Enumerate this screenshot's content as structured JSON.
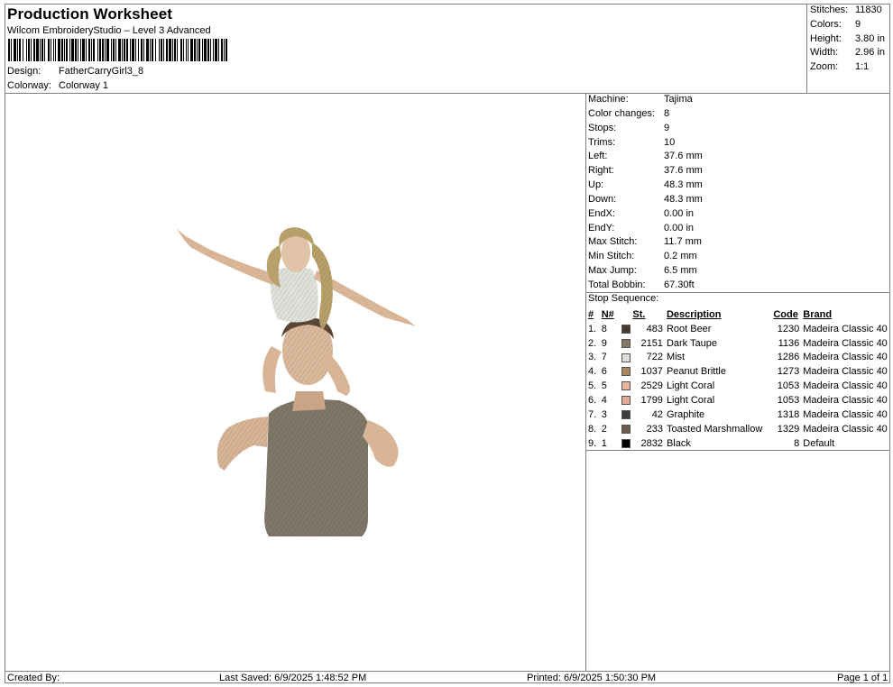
{
  "header": {
    "title": "Production Worksheet",
    "subtitle": "Wilcom EmbroideryStudio – Level 3 Advanced",
    "design_label": "Design:",
    "design_value": "FatherCarryGirl3_8",
    "colorway_label": "Colorway:",
    "colorway_value": "Colorway 1"
  },
  "summary": [
    {
      "label": "Stitches:",
      "value": "11830"
    },
    {
      "label": "Colors:",
      "value": "9"
    },
    {
      "label": "Height:",
      "value": "3.80 in"
    },
    {
      "label": "Width:",
      "value": "2.96 in"
    },
    {
      "label": "Zoom:",
      "value": "1:1"
    }
  ],
  "details": [
    {
      "label": "Machine:",
      "value": "Tajima"
    },
    {
      "label": "Color changes:",
      "value": "8"
    },
    {
      "label": "Stops:",
      "value": "9"
    },
    {
      "label": "Trims:",
      "value": "10"
    },
    {
      "label": "Left:",
      "value": "37.6 mm"
    },
    {
      "label": "Right:",
      "value": "37.6 mm"
    },
    {
      "label": "Up:",
      "value": "48.3 mm"
    },
    {
      "label": "Down:",
      "value": "48.3 mm"
    },
    {
      "label": "EndX:",
      "value": "0.00 in"
    },
    {
      "label": "EndY:",
      "value": "0.00 in"
    },
    {
      "label": "Max Stitch:",
      "value": "11.7 mm"
    },
    {
      "label": "Min Stitch:",
      "value": "0.2 mm"
    },
    {
      "label": "Max Jump:",
      "value": "6.5 mm"
    },
    {
      "label": "Total Bobbin:",
      "value": "67.30ft"
    }
  ],
  "stop_sequence": {
    "title": "Stop Sequence:",
    "headers": {
      "num": "#",
      "n": "N#",
      "st": "St.",
      "desc": "Description",
      "code": "Code",
      "brand": "Brand"
    },
    "rows": [
      {
        "num": "1.",
        "n": "8",
        "color": "#4a3a2e",
        "st": "483",
        "desc": "Root Beer",
        "code": "1230",
        "brand": "Madeira Classic 40"
      },
      {
        "num": "2.",
        "n": "9",
        "color": "#857866",
        "st": "2151",
        "desc": "Dark Taupe",
        "code": "1136",
        "brand": "Madeira Classic 40"
      },
      {
        "num": "3.",
        "n": "7",
        "color": "#dcdfd8",
        "st": "722",
        "desc": "Mist",
        "code": "1286",
        "brand": "Madeira Classic 40"
      },
      {
        "num": "4.",
        "n": "6",
        "color": "#a8875f",
        "st": "1037",
        "desc": "Peanut Brittle",
        "code": "1273",
        "brand": "Madeira Classic 40"
      },
      {
        "num": "5.",
        "n": "5",
        "color": "#e8b49e",
        "st": "2529",
        "desc": "Light Coral",
        "code": "1053",
        "brand": "Madeira Classic 40"
      },
      {
        "num": "6.",
        "n": "4",
        "color": "#e3ab96",
        "st": "1799",
        "desc": "Light Coral",
        "code": "1053",
        "brand": "Madeira Classic 40"
      },
      {
        "num": "7.",
        "n": "3",
        "color": "#3d3d3d",
        "st": "42",
        "desc": "Graphite",
        "code": "1318",
        "brand": "Madeira Classic 40"
      },
      {
        "num": "8.",
        "n": "2",
        "color": "#6e5c4b",
        "st": "233",
        "desc": "Toasted Marshmallow",
        "code": "1329",
        "brand": "Madeira Classic 40"
      },
      {
        "num": "9.",
        "n": "1",
        "color": "#000000",
        "st": "2832",
        "desc": "Black",
        "code": "8",
        "brand": "Default"
      }
    ]
  },
  "footer": {
    "created_by": "Created By:",
    "last_saved": "Last Saved: 6/9/2025 1:48:52 PM",
    "printed": "Printed: 6/9/2025 1:50:30 PM",
    "page": "Page 1 of 1"
  }
}
